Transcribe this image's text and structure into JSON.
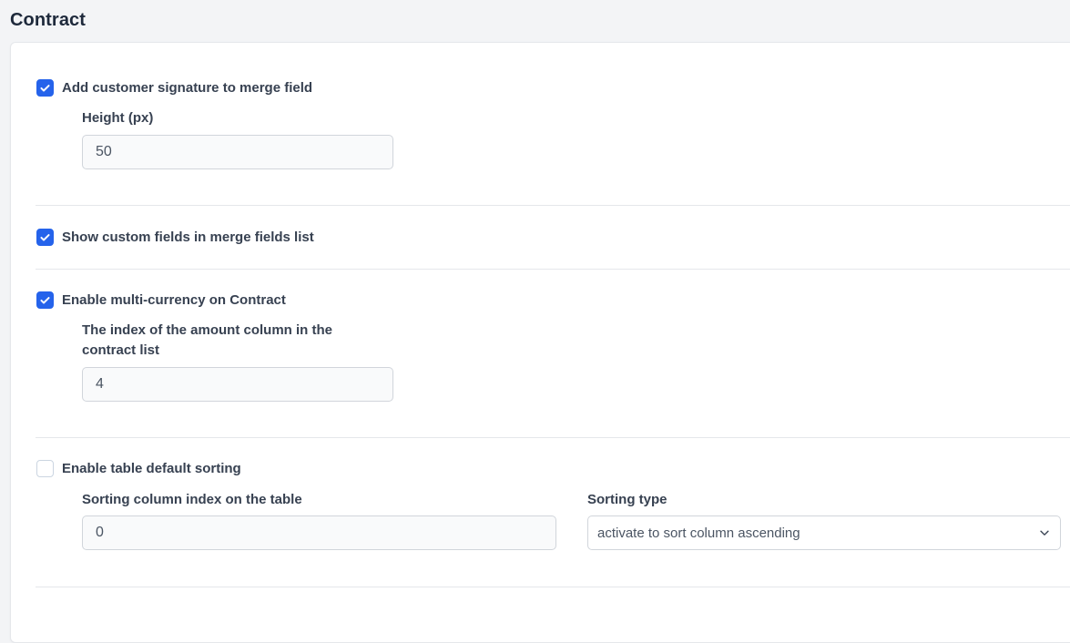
{
  "page": {
    "title": "Contract"
  },
  "settings": {
    "signature": {
      "label": "Add customer signature to merge field",
      "checked": true,
      "height_label": "Height (px)",
      "height_value": "50"
    },
    "custom_fields": {
      "label": "Show custom fields in merge fields list",
      "checked": true
    },
    "multi_currency": {
      "label": "Enable multi-currency on Contract",
      "checked": true,
      "index_label_line1": "The index of the amount column in the",
      "index_label_line2": "contract list",
      "index_value": "4"
    },
    "default_sorting": {
      "label": "Enable table default sorting",
      "checked": false,
      "column_label": "Sorting column index on the table",
      "column_value": "0",
      "type_label": "Sorting type",
      "type_value": "activate to sort column ascending"
    }
  },
  "colors": {
    "accent": "#2563eb",
    "background": "#f3f4f6",
    "panel": "#ffffff"
  },
  "icons": {
    "check": "check-icon",
    "dropdown": "chevron-down-icon"
  }
}
